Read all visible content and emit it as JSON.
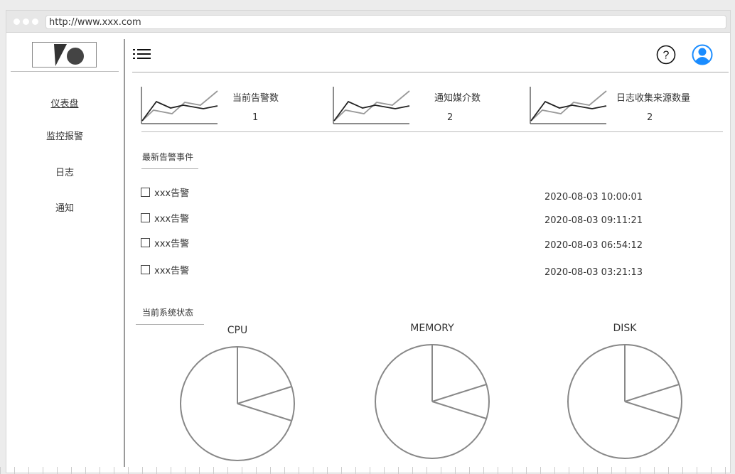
{
  "browser": {
    "url": "http://www.xxx.com"
  },
  "sidebar": {
    "items": [
      {
        "label": "仪表盘",
        "active": true
      },
      {
        "label": "监控报警",
        "active": false
      },
      {
        "label": "日志",
        "active": false
      },
      {
        "label": "通知",
        "active": false
      }
    ]
  },
  "header": {
    "menu_icon": "list-icon",
    "help_icon": "question-circle-icon",
    "user_icon": "user-avatar-icon",
    "accent": "#1a8cff"
  },
  "stats": [
    {
      "label": "当前告警数",
      "value": "1"
    },
    {
      "label": "通知媒介数",
      "value": "2"
    },
    {
      "label": "日志收集来源数量",
      "value": "2"
    }
  ],
  "alerts_section": {
    "title": "最新告警事件",
    "items": [
      {
        "label": "xxx告警",
        "time": "2020-08-03 10:00:01"
      },
      {
        "label": "xxx告警",
        "time": "2020-08-03 09:11:21"
      },
      {
        "label": "xxx告警",
        "time": "2020-08-03 06:54:12"
      },
      {
        "label": "xxx告警",
        "time": "2020-08-03 03:21:13"
      }
    ]
  },
  "status_section": {
    "title": "当前系统状态",
    "charts": [
      {
        "title": "CPU"
      },
      {
        "title": "MEMORY"
      },
      {
        "title": "DISK"
      }
    ]
  }
}
